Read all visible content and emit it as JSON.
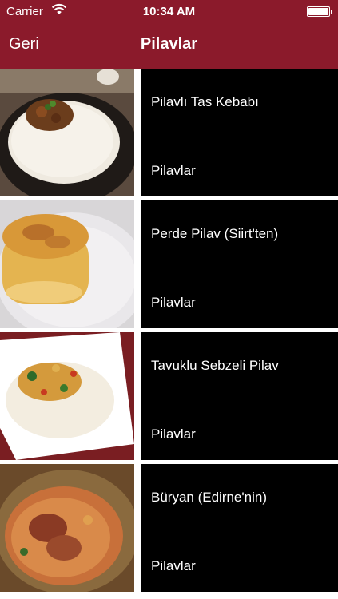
{
  "status_bar": {
    "carrier": "Carrier",
    "time": "10:34 AM"
  },
  "nav": {
    "back_label": "Geri",
    "title": "Pilavlar",
    "bar_color": "#8b1a2b"
  },
  "items": [
    {
      "name": "Pilavlı Tas Kebabı",
      "category": "Pilavlar"
    },
    {
      "name": "Perde Pilav (Siirt'ten)",
      "category": "Pilavlar"
    },
    {
      "name": "Tavuklu Sebzeli Pilav",
      "category": "Pilavlar"
    },
    {
      "name": "Büryan (Edirne'nin)",
      "category": "Pilavlar"
    }
  ]
}
